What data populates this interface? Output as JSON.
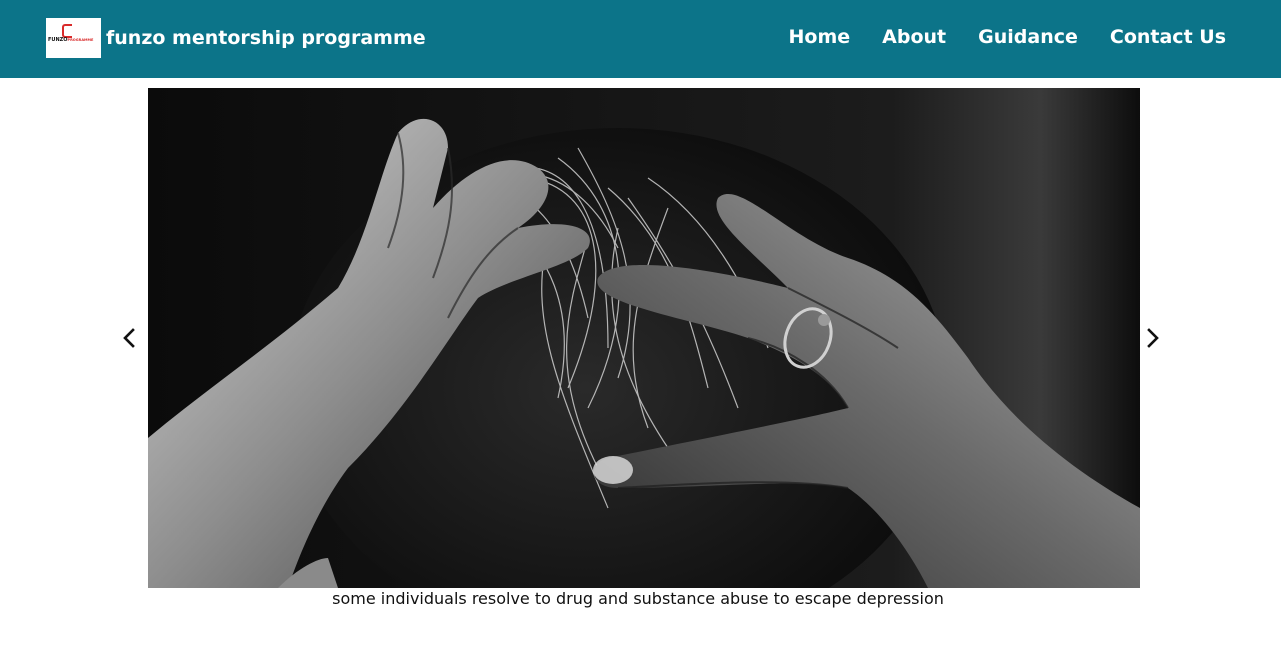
{
  "header": {
    "logo": {
      "wordmark": "FUNZO",
      "wordmark_suffix": "PROGRAMME"
    },
    "brand_title": "funzo mentorship programme",
    "nav": [
      {
        "label": "Home"
      },
      {
        "label": "About"
      },
      {
        "label": "Guidance"
      },
      {
        "label": "Contact Us"
      }
    ],
    "background_color": "#0c7489"
  },
  "carousel": {
    "slide_image": "grayscale photo of a person gripping their hair with both hands",
    "prev_icon": "chevron-left-icon",
    "next_icon": "chevron-right-icon",
    "caption": "some individuals resolve to drug and substance abuse to escape depression"
  }
}
